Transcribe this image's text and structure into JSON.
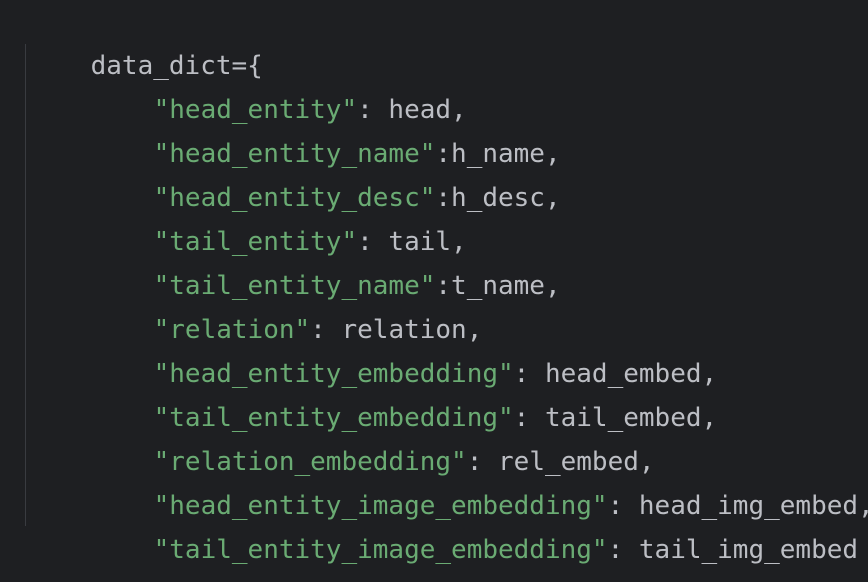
{
  "colors": {
    "background": "#1e1f22",
    "text": "#bcbec4",
    "string": "#6aab73",
    "indent_guide": "#393b40"
  },
  "code": {
    "open_line": "data_dict={",
    "close_line": "}",
    "entries": [
      {
        "key": "\"head_entity\"",
        "rest": ": head,"
      },
      {
        "key": "\"head_entity_name\"",
        "rest": ":h_name,"
      },
      {
        "key": "\"head_entity_desc\"",
        "rest": ":h_desc,"
      },
      {
        "key": "\"tail_entity\"",
        "rest": ": tail,"
      },
      {
        "key": "\"tail_entity_name\"",
        "rest": ":t_name,"
      },
      {
        "key": "\"relation\"",
        "rest": ": relation,"
      },
      {
        "key": "\"head_entity_embedding\"",
        "rest": ": head_embed,"
      },
      {
        "key": "\"tail_entity_embedding\"",
        "rest": ": tail_embed,"
      },
      {
        "key": "\"relation_embedding\"",
        "rest": ": rel_embed,"
      },
      {
        "key": "\"head_entity_image_embedding\"",
        "rest": ": head_img_embed,"
      },
      {
        "key": "\"tail_entity_image_embedding\"",
        "rest": ": tail_img_embed"
      }
    ]
  }
}
